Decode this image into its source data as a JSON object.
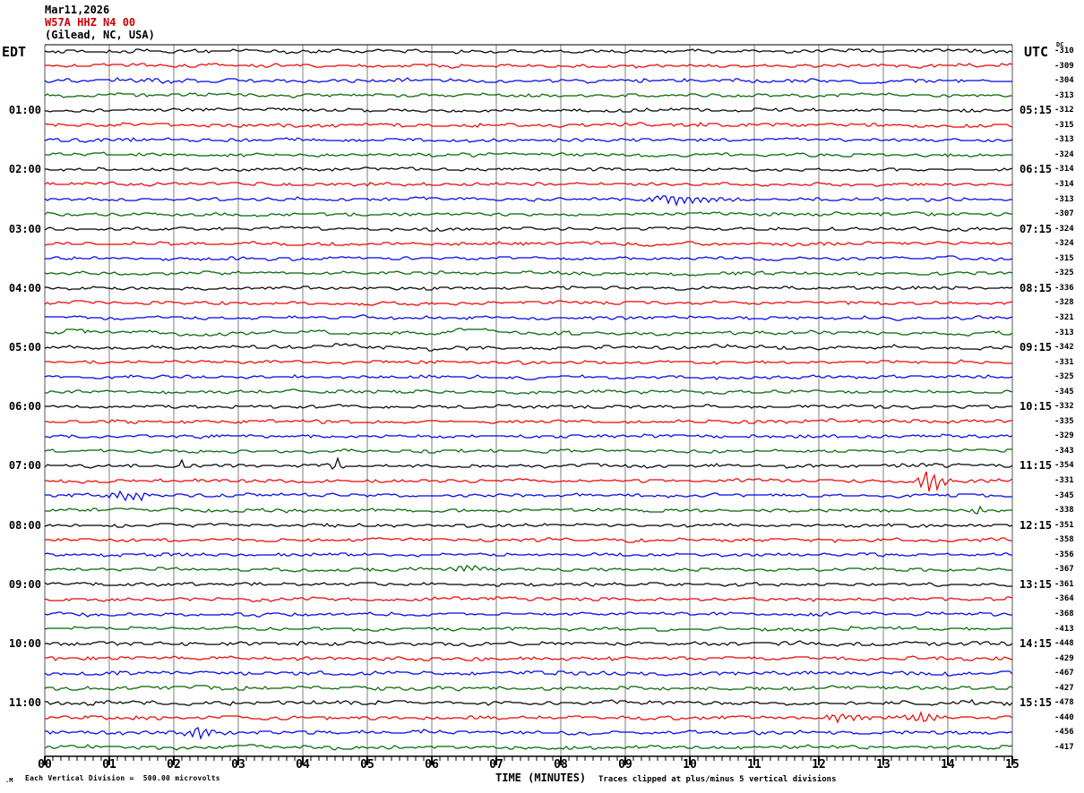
{
  "title": {
    "line1": "Mar11,2026",
    "line2": "W57A HHZ N4 00",
    "line3": "(Gilead, NC, USA)"
  },
  "axes": {
    "left_header": "EDT",
    "right_header": "UTC",
    "dc_header": "DC",
    "x_label": "TIME (MINUTES)",
    "x_ticks": [
      "00",
      "01",
      "02",
      "03",
      "04",
      "05",
      "06",
      "07",
      "08",
      "09",
      "10",
      "11",
      "12",
      "13",
      "14",
      "15"
    ],
    "footer_glyph": ".M",
    "footer_left": "Each Vertical Division =  500.00 microvolts",
    "footer_right": "Traces clipped at plus/minus 5 vertical divisions"
  },
  "chart_data": {
    "type": "line",
    "subtype": "helicorder",
    "minutes_per_line": 15,
    "x_range": [
      0,
      15
    ],
    "minor_ticks_per_minute": 8,
    "volts_per_division": "500.00 microvolts",
    "clip_divisions": 5,
    "trace_colors": [
      "#000000",
      "#ee0000",
      "#0000ee",
      "#006600"
    ],
    "grid_color": "#7d7d7d",
    "rows_count": 48,
    "left_labels": {
      "4": "01:00",
      "8": "02:00",
      "12": "03:00",
      "16": "04:00",
      "20": "05:00",
      "24": "06:00",
      "28": "07:00",
      "32": "08:00",
      "36": "09:00",
      "40": "10:00",
      "44": "11:00"
    },
    "right_labels": {
      "4": "05:15",
      "8": "06:15",
      "12": "07:15",
      "16": "08:15",
      "20": "09:15",
      "24": "10:15",
      "28": "11:15",
      "32": "12:15",
      "36": "13:15",
      "40": "14:15",
      "44": "15:15"
    },
    "dc_values": [
      "-310",
      "-309",
      "-304",
      "-313",
      "-312",
      "-315",
      "-313",
      "-324",
      "-314",
      "-314",
      "-313",
      "-307",
      "-324",
      "-324",
      "-315",
      "-325",
      "-336",
      "-328",
      "-321",
      "-313",
      "-342",
      "-331",
      "-325",
      "-345",
      "-332",
      "-335",
      "-329",
      "-343",
      "-354",
      "-331",
      "-345",
      "-338",
      "-351",
      "-358",
      "-356",
      "-367",
      "-361",
      "-364",
      "-368",
      "-413",
      "-448",
      "-429",
      "-467",
      "-427",
      "-478",
      "-440",
      "-456",
      "-417"
    ],
    "row_overrides": {
      "2": {
        "amp": 2.0
      },
      "5": {
        "amp": 1.8
      },
      "10": {
        "events": [
          [
            9.9,
            4,
            0.6
          ]
        ]
      },
      "19": {
        "amp": 1.2,
        "smooth": 2.4
      },
      "20": {
        "smooth": 1.9
      },
      "28": {
        "events": [
          [
            2.1,
            5,
            0.06
          ],
          [
            4.55,
            9,
            0.09
          ]
        ]
      },
      "29": {
        "events": [
          [
            13.75,
            10,
            0.22
          ]
        ]
      },
      "30": {
        "events": [
          [
            1.3,
            6,
            0.28
          ]
        ]
      },
      "31": {
        "events": [
          [
            14.45,
            5,
            0.12
          ]
        ]
      },
      "35": {
        "events": [
          [
            6.55,
            5,
            0.18
          ]
        ]
      },
      "40": {
        "amp": 1.8
      },
      "41": {
        "amp": 1.8
      },
      "42": {
        "amp": 1.8
      },
      "43": {
        "amp": 1.8
      },
      "44": {
        "amp": 1.9,
        "events": [
          [
            14.35,
            5,
            0.05
          ]
        ]
      },
      "45": {
        "amp": 1.8,
        "events": [
          [
            12.4,
            4,
            0.35
          ],
          [
            13.6,
            5,
            0.3
          ]
        ]
      },
      "46": {
        "amp": 1.8,
        "events": [
          [
            2.4,
            5,
            0.3
          ]
        ]
      },
      "47": {
        "amp": 1.7
      }
    }
  }
}
